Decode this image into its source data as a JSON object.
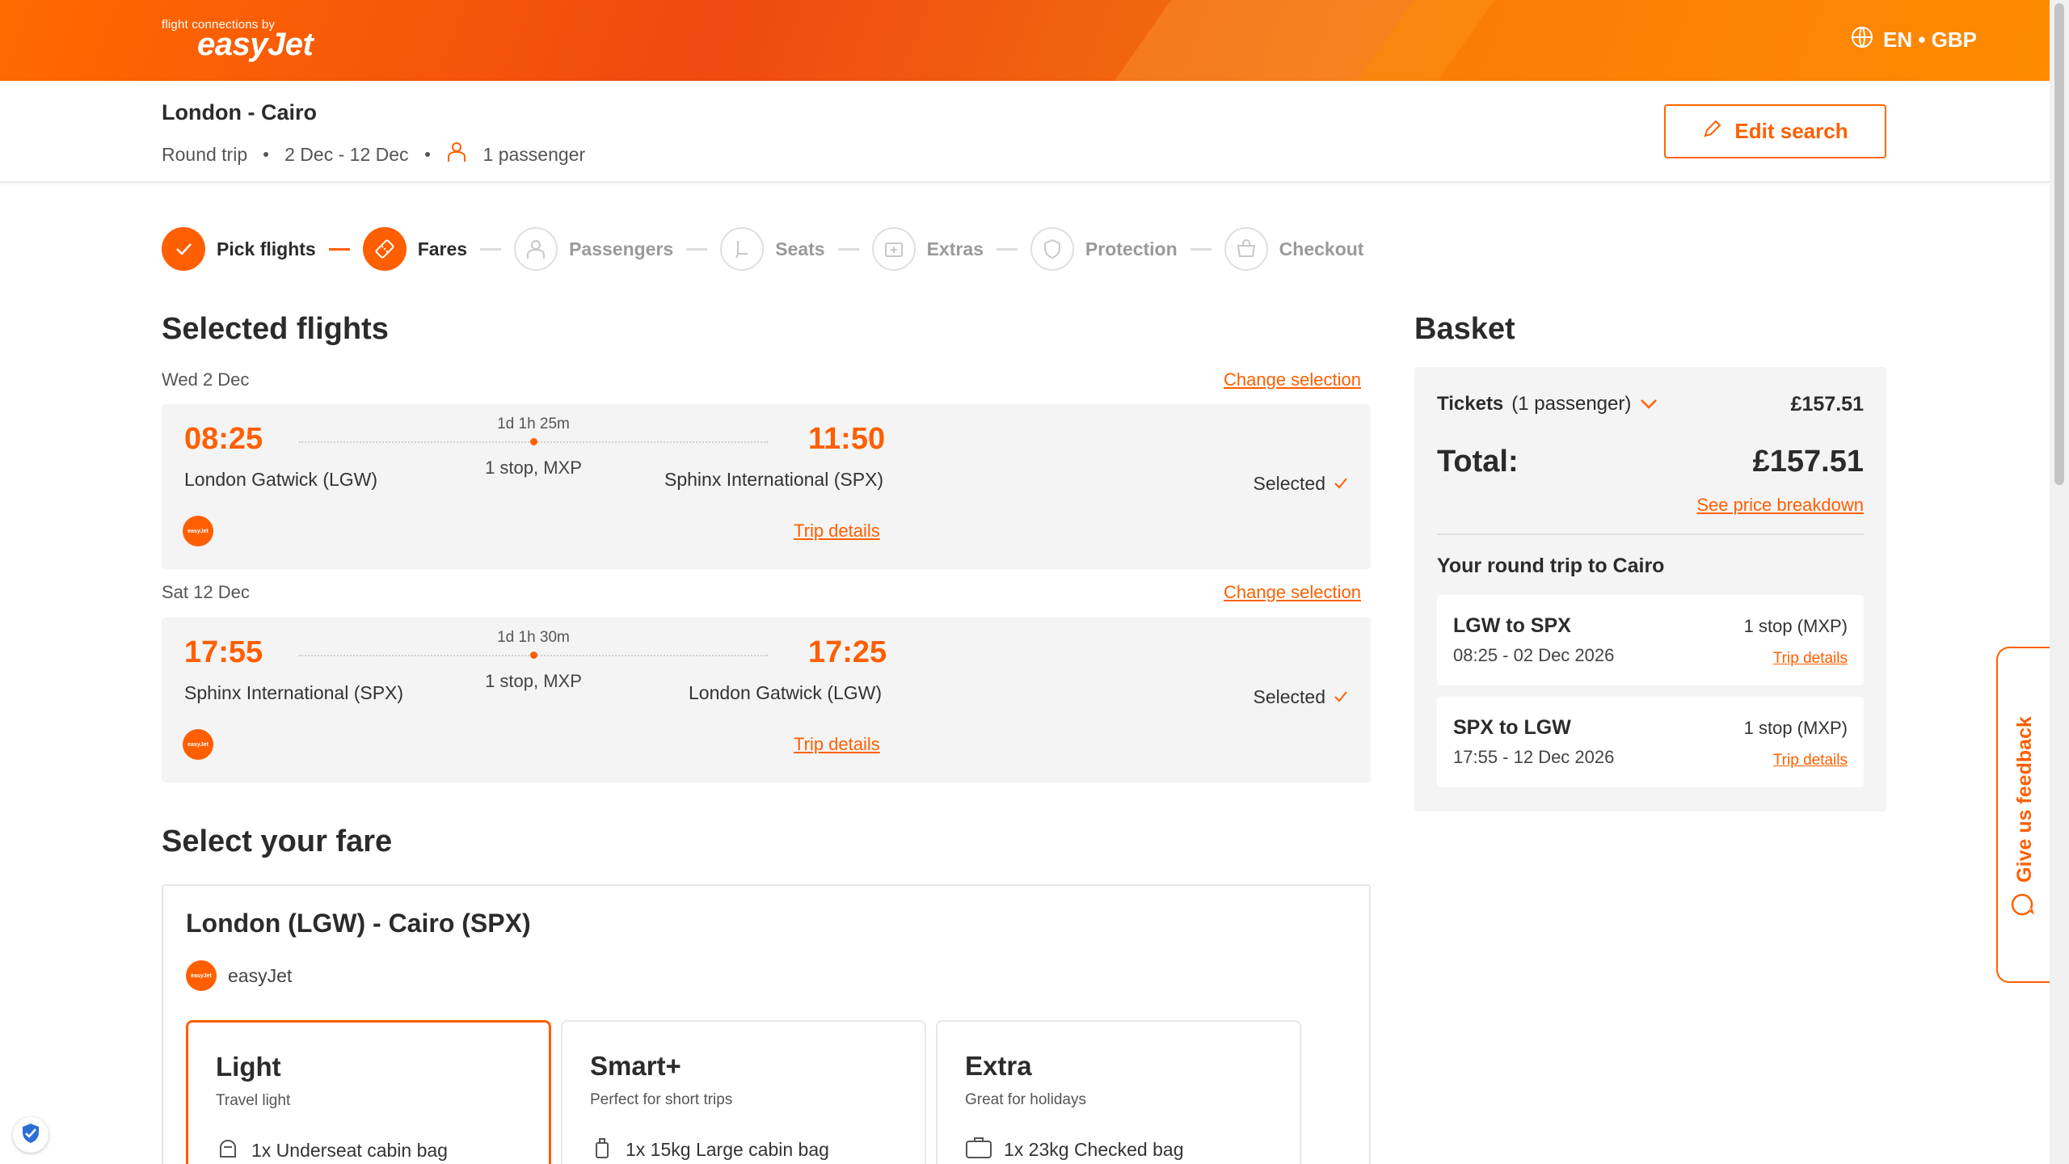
{
  "header": {
    "logo_tagline": "flight connections by",
    "logo_brand": "easyJet",
    "locale": "EN • GBP"
  },
  "search_summary": {
    "route": "London - Cairo",
    "trip_type": "Round trip",
    "dates": "2 Dec - 12 Dec",
    "passengers": "1 passenger",
    "edit_label": "Edit search"
  },
  "steps": [
    {
      "label": "Pick flights",
      "state": "done",
      "icon": "check-icon"
    },
    {
      "label": "Fares",
      "state": "active",
      "icon": "ticket-icon"
    },
    {
      "label": "Passengers",
      "state": "todo",
      "icon": "person-icon"
    },
    {
      "label": "Seats",
      "state": "todo",
      "icon": "seat-icon"
    },
    {
      "label": "Extras",
      "state": "todo",
      "icon": "extras-icon"
    },
    {
      "label": "Protection",
      "state": "todo",
      "icon": "shield-icon"
    },
    {
      "label": "Checkout",
      "state": "todo",
      "icon": "cart-icon"
    }
  ],
  "selected_flights": {
    "title": "Selected flights",
    "change_label": "Change selection",
    "flights": [
      {
        "date": "Wed 2 Dec",
        "dep_time": "08:25",
        "dep_airport": "London Gatwick (LGW)",
        "duration": "1d 1h 25m",
        "stops": "1 stop, MXP",
        "arr_time": "11:50",
        "arr_airport": "Sphinx International (SPX)",
        "trip_details": "Trip details",
        "status": "Selected",
        "airline_logo": "easyJet"
      },
      {
        "date": "Sat 12 Dec",
        "dep_time": "17:55",
        "dep_airport": "Sphinx International (SPX)",
        "duration": "1d 1h 30m",
        "stops": "1 stop, MXP",
        "arr_time": "17:25",
        "arr_airport": "London Gatwick (LGW)",
        "trip_details": "Trip details",
        "status": "Selected",
        "airline_logo": "easyJet"
      }
    ]
  },
  "fare": {
    "title": "Select your fare",
    "route": "London (LGW) - Cairo (SPX)",
    "carrier": "easyJet",
    "carrier_logo": "easyJet",
    "options": [
      {
        "name": "Light",
        "desc": "Travel light",
        "baggage": "1x Underseat cabin bag",
        "selected": true
      },
      {
        "name": "Smart+",
        "desc": "Perfect for short trips",
        "baggage": "1x 15kg Large cabin bag",
        "selected": false
      },
      {
        "name": "Extra",
        "desc": "Great for holidays",
        "baggage": "1x 23kg Checked bag",
        "selected": false
      }
    ]
  },
  "basket": {
    "title": "Basket",
    "tickets_label": "Tickets",
    "tickets_count": "(1 passenger)",
    "tickets_price": "£157.51",
    "total_label": "Total:",
    "total_value": "£157.51",
    "breakdown_label": "See price breakdown",
    "roundtrip_title": "Your round trip to Cairo",
    "legs": [
      {
        "route": "LGW to SPX",
        "time": "08:25 - 02 Dec 2026",
        "stops": "1 stop (MXP)",
        "details": "Trip details"
      },
      {
        "route": "SPX to LGW",
        "time": "17:55 - 12 Dec 2026",
        "stops": "1 stop (MXP)",
        "details": "Trip details"
      }
    ]
  },
  "feedback": {
    "label": "Give us feedback"
  },
  "colors": {
    "accent": "#ff5f00",
    "card_bg": "#f4f4f4",
    "muted": "#9a9a9a"
  }
}
